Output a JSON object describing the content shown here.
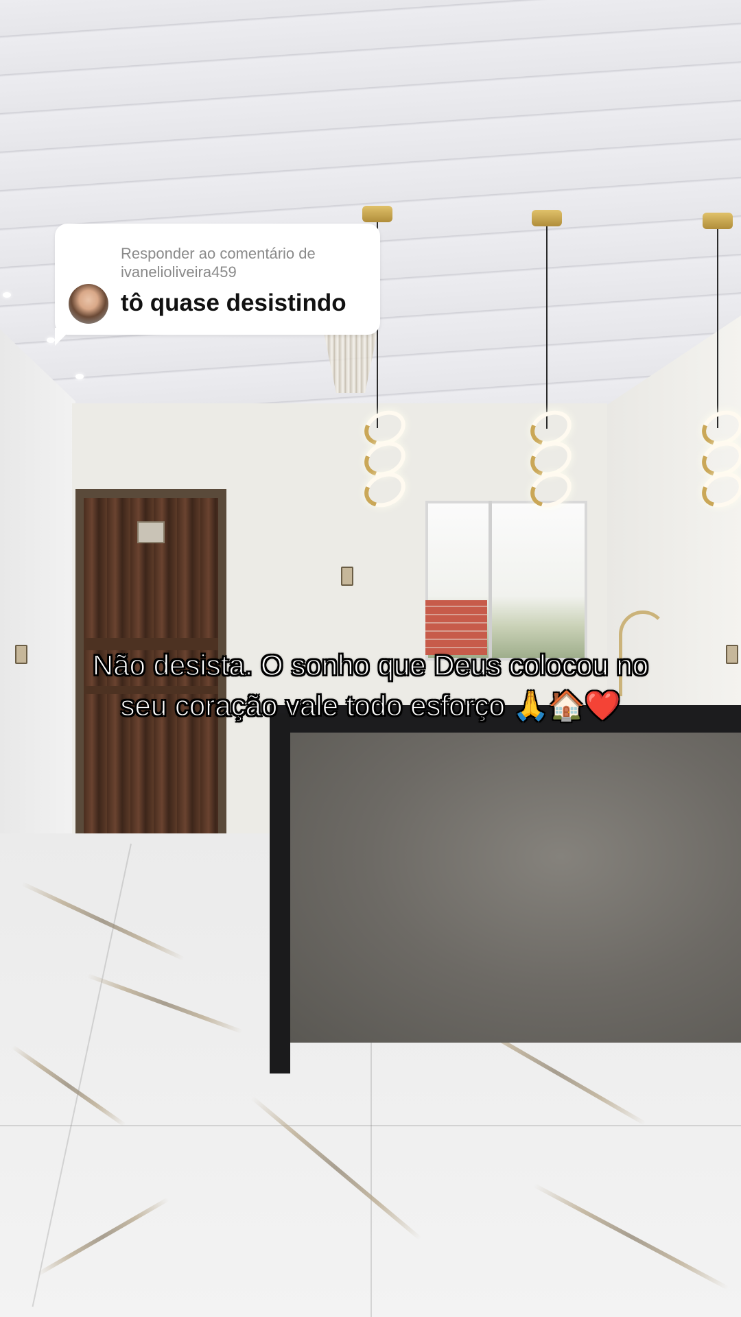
{
  "reply": {
    "header": "Responder ao comentário de ivanelioliveira459",
    "comment": "tô quase desistindo"
  },
  "caption": "Não desista. O sonho que Deus colocou no seu coração vale todo esforço 🙏🏠❤️",
  "colors": {
    "bubble_bg": "#ffffff",
    "header_text": "#8a8a8a",
    "comment_text": "#111111",
    "caption_text": "#ffffff",
    "caption_outline": "#000000"
  },
  "icons": {
    "avatar": "profile-photo-avatar"
  }
}
